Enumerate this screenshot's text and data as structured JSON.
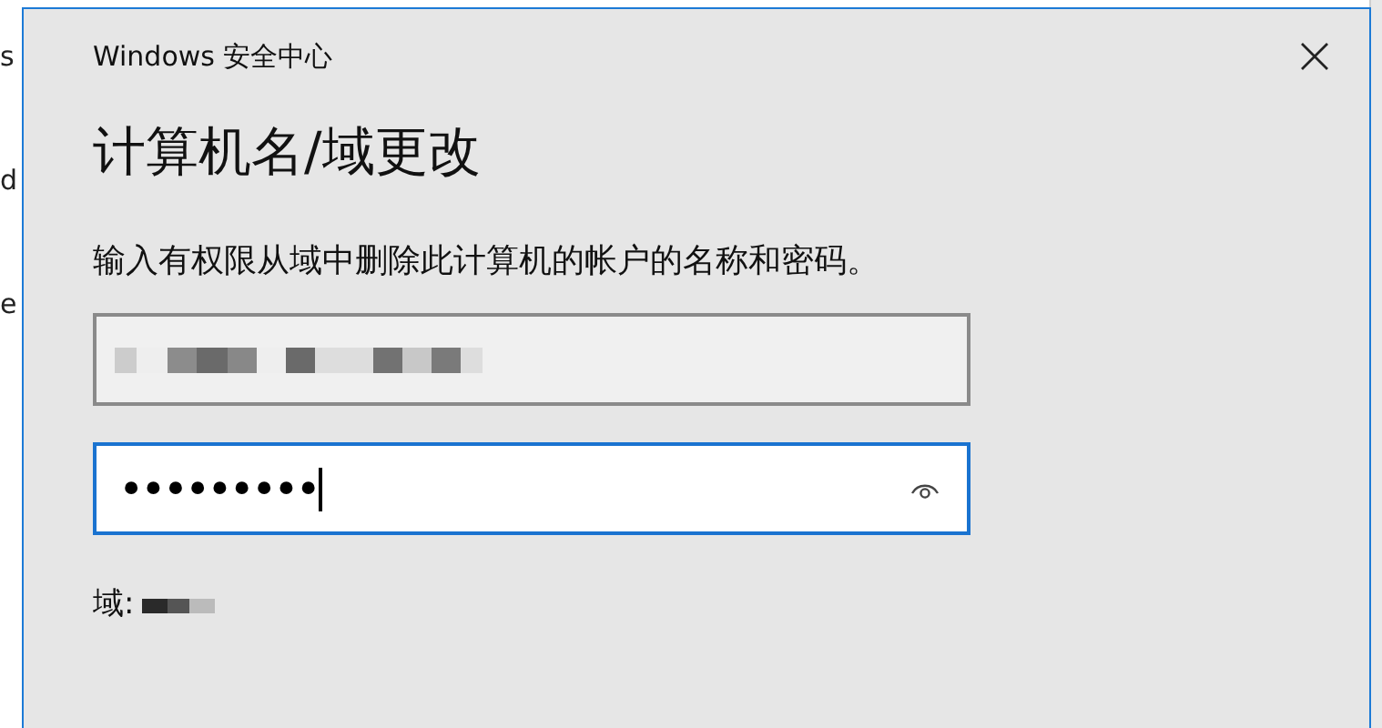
{
  "background_window": {
    "letters": [
      "s",
      "d",
      "e"
    ]
  },
  "dialog": {
    "title": "Windows 安全中心",
    "heading": "计算机名/域更改",
    "instruction": "输入有权限从域中删除此计算机的帐户的名称和密码。",
    "username_field": {
      "redacted": true
    },
    "password_field": {
      "value": "•••••••••",
      "focused": true
    },
    "domain_label": "域:",
    "domain_value": {
      "redacted": true
    }
  }
}
